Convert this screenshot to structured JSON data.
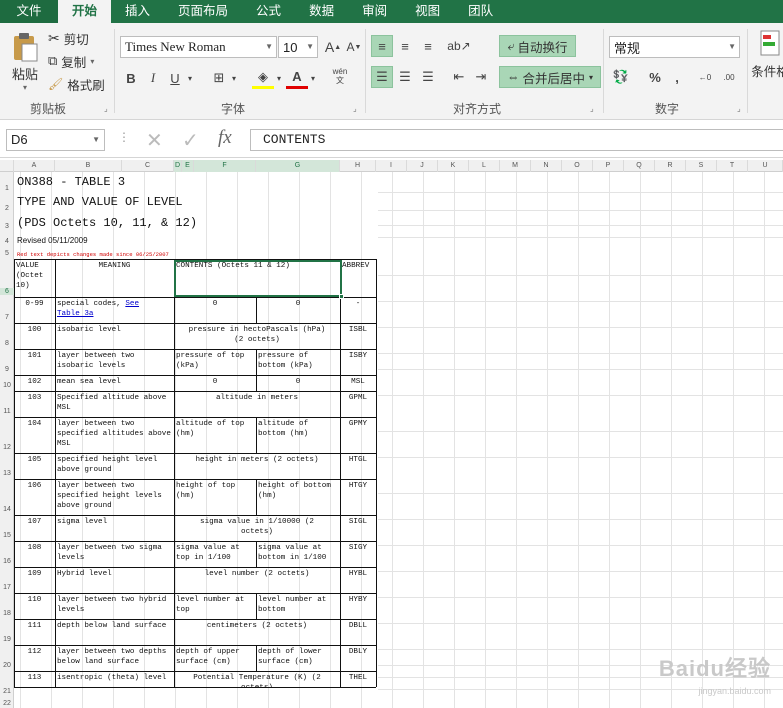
{
  "tabs": [
    "文件",
    "开始",
    "插入",
    "页面布局",
    "公式",
    "数据",
    "审阅",
    "视图",
    "团队"
  ],
  "ribbon": {
    "paste": "粘贴",
    "cut": "剪切",
    "copy": "复制",
    "format_painter": "格式刷",
    "clipboard": "剪贴板",
    "font_name": "Times New Roman",
    "font_size": "10",
    "font_group": "字体",
    "phonetic": "wén",
    "wrap_text": "自动换行",
    "merge_center": "合并后居中",
    "alignment_group": "对齐方式",
    "number_format": "常规",
    "number_group": "数字",
    "cond_format": "条件格"
  },
  "formula_bar": {
    "name_box": "D6",
    "content": "CONTENTS",
    "fx": "fx"
  },
  "columns": [
    "A",
    "B",
    "C",
    "D",
    "E",
    "F",
    "G",
    "H",
    "I",
    "J",
    "K",
    "L",
    "M",
    "N",
    "O",
    "P",
    "Q",
    "R",
    "S",
    "T",
    "U"
  ],
  "rows": [
    "1",
    "2",
    "3",
    "4",
    "5",
    "6",
    "7",
    "8",
    "9",
    "10",
    "11",
    "12",
    "13",
    "14",
    "15",
    "16",
    "17",
    "18",
    "19",
    "20",
    "21",
    "22"
  ],
  "sheet": {
    "title1": "ON388 - TABLE 3",
    "title2": "TYPE AND VALUE OF LEVEL",
    "title3": "(PDS Octets 10, 11, & 12)",
    "revised": "Revised 05/11/2009",
    "red_note": "Red text depicts changes made since 06/25/2007",
    "headers": {
      "value": "VALUE (Octet 10)",
      "meaning": "MEANING",
      "contents": "CONTENTS (Octets 11 & 12)",
      "abbrev": "ABBREV"
    },
    "rows": [
      {
        "value": "0-99",
        "meaning": "special codes, ",
        "link1": "See",
        "link2": "Table 3a",
        "c1": "0",
        "c2": "0",
        "abbrev": "-"
      },
      {
        "value": "100",
        "meaning": "isobaric level",
        "c1": "pressure in hectoPascals (hPa) (2 octets)",
        "abbrev": "ISBL"
      },
      {
        "value": "101",
        "meaning": "layer between two isobaric levels",
        "c1": "pressure of top (kPa)",
        "c2": "pressure of bottom (kPa)",
        "abbrev": "ISBY"
      },
      {
        "value": "102",
        "meaning": "mean sea level",
        "c1": "0",
        "c2": "0",
        "abbrev": "MSL"
      },
      {
        "value": "103",
        "meaning": "Specified altitude above MSL",
        "c1": "altitude in meters",
        "abbrev": "GPML"
      },
      {
        "value": "104",
        "meaning": "layer between two specified altitudes above MSL",
        "c1": "altitude of top (hm)",
        "c2": "altitude of bottom (hm)",
        "abbrev": "GPMY"
      },
      {
        "value": "105",
        "meaning": "specified height level above ground",
        "c1": "height in meters (2 octets)",
        "abbrev": "HTGL"
      },
      {
        "value": "106",
        "meaning": "layer between two specified height levels above ground",
        "c1": "height of top (hm)",
        "c2": "height of bottom (hm)",
        "abbrev": "HTGY"
      },
      {
        "value": "107",
        "meaning": "sigma level",
        "c1": "sigma value in 1/10000 (2 octets)",
        "abbrev": "SIGL"
      },
      {
        "value": "108",
        "meaning": "layer between two sigma levels",
        "c1": "sigma value at top in 1/100",
        "c2": "sigma value at bottom in 1/100",
        "abbrev": "SIGY"
      },
      {
        "value": "109",
        "meaning": "Hybrid level",
        "c1": "level number (2 octets)",
        "abbrev": "HYBL"
      },
      {
        "value": "110",
        "meaning": "layer between two hybrid levels",
        "c1": "level number at top",
        "c2": "level number at bottom",
        "abbrev": "HYBY"
      },
      {
        "value": "111",
        "meaning": "depth below land surface",
        "c1": "centimeters (2 octets)",
        "abbrev": "DBLL"
      },
      {
        "value": "112",
        "meaning": "layer between two depths below land surface",
        "c1": "depth of upper surface (cm)",
        "c2": "depth of lower surface (cm)",
        "abbrev": "DBLY"
      },
      {
        "value": "113",
        "meaning": "isentropic (theta) level",
        "c1": "Potential Temperature (K) (2 octets)",
        "abbrev": "THEL"
      }
    ]
  },
  "watermark": {
    "brand": "Baidu经验",
    "url": "jingyan.baidu.com"
  }
}
